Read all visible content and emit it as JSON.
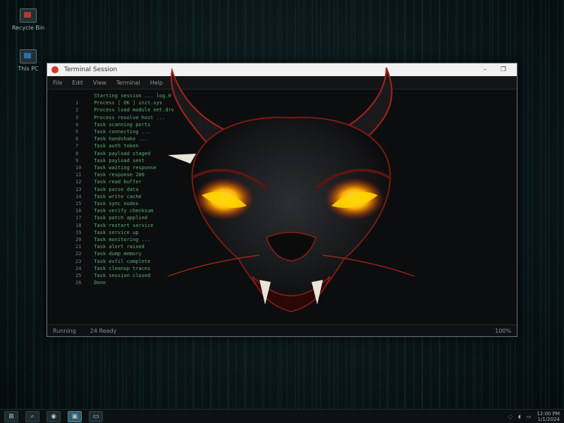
{
  "desktop": {
    "icons": [
      {
        "name": "recycle",
        "label": "Recycle Bin"
      },
      {
        "name": "monitor",
        "label": "This PC"
      }
    ]
  },
  "window": {
    "title": "Terminal Session",
    "menu": [
      "File",
      "Edit",
      "View",
      "Terminal",
      "Help"
    ],
    "console_lines": [
      {
        "num": "",
        "text": "  Starting session ...   log.0"
      },
      {
        "num": "1",
        "text": "  Process   [ OK ]   init.sys"
      },
      {
        "num": "2",
        "text": "  Process   load module  net.drv"
      },
      {
        "num": "3",
        "text": "  Process   resolve host ..."
      },
      {
        "num": "4",
        "text": "  Task      scanning ports"
      },
      {
        "num": "5",
        "text": "  Task      connecting ..."
      },
      {
        "num": "6",
        "text": "  Task      handshake ..."
      },
      {
        "num": "7",
        "text": "  Task      auth token"
      },
      {
        "num": "8",
        "text": "  Task      payload staged"
      },
      {
        "num": "9",
        "text": "  Task      payload sent"
      },
      {
        "num": "10",
        "text": "  Task      waiting response"
      },
      {
        "num": "11",
        "text": "  Task      response 200"
      },
      {
        "num": "12",
        "text": "  Task      read buffer"
      },
      {
        "num": "13",
        "text": "  Task      parse data"
      },
      {
        "num": "14",
        "text": "  Task      write cache"
      },
      {
        "num": "15",
        "text": "  Task      sync nodes"
      },
      {
        "num": "16",
        "text": "  Task      verify checksum"
      },
      {
        "num": "17",
        "text": "  Task      patch applied"
      },
      {
        "num": "18",
        "text": "  Task      restart service"
      },
      {
        "num": "19",
        "text": "  Task      service up"
      },
      {
        "num": "20",
        "text": "  Task      monitoring ..."
      },
      {
        "num": "21",
        "text": "  Task      alert raised"
      },
      {
        "num": "22",
        "text": "  Task      dump memory"
      },
      {
        "num": "23",
        "text": "  Task      exfil complete"
      },
      {
        "num": "24",
        "text": "  Task      cleanup traces"
      },
      {
        "num": "25",
        "text": "  Task      session closed"
      },
      {
        "num": "26",
        "text": "  Done"
      }
    ],
    "status_left": "Running",
    "status_mid": "24    Ready",
    "status_right": "100%"
  },
  "taskbar": {
    "time": "12:00 PM",
    "date": "1/1/2024"
  },
  "colors": {
    "eye_glow": "#ffb000",
    "accent": "#d23a2c"
  }
}
